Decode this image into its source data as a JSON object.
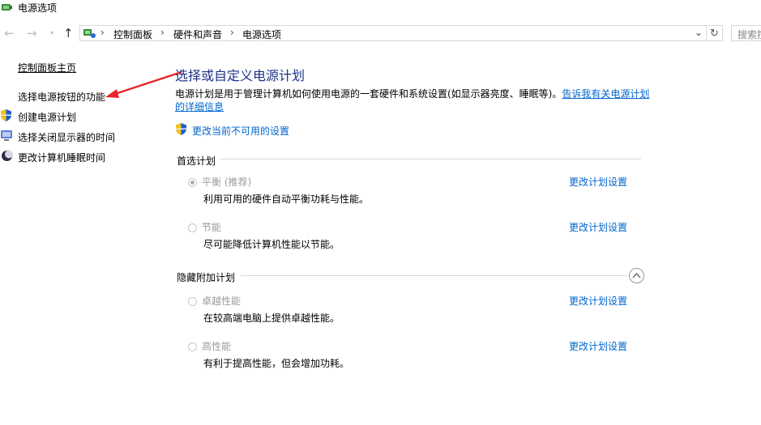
{
  "window": {
    "title": "电源选项",
    "icon": "power-options-icon"
  },
  "nav": {
    "back_icon": "arrow-left-icon",
    "forward_icon": "arrow-right-icon",
    "recent_icon": "chevron-down-icon",
    "up_icon": "arrow-up-icon"
  },
  "address": {
    "breadcrumbs": [
      "控制面板",
      "硬件和声音",
      "电源选项"
    ],
    "separator": "›",
    "dropdown_icon": "chevron-down-icon",
    "refresh_icon": "refresh-icon"
  },
  "search": {
    "placeholder": "搜索控"
  },
  "sidebar": {
    "home": "控制面板主页",
    "items": [
      {
        "label": "选择电源按钮的功能",
        "icon": ""
      },
      {
        "label": "创建电源计划",
        "icon": "shield-icon"
      },
      {
        "label": "选择关闭显示器的时间",
        "icon": "monitor-icon"
      },
      {
        "label": "更改计算机睡眠时间",
        "icon": "moon-icon"
      }
    ]
  },
  "main": {
    "heading": "选择或自定义电源计划",
    "description": "电源计划是用于管理计算机如何使用电源的一套硬件和系统设置(如显示器亮度、睡眠等)。",
    "description_link": "告诉我有关电源计划的详细信息",
    "change_unavailable": "更改当前不可用的设置",
    "preferred_label": "首选计划",
    "hidden_label": "隐藏附加计划",
    "plans": [
      {
        "name": "平衡 (推荐)",
        "desc": "利用可用的硬件自动平衡功耗与性能。",
        "link": "更改计划设置",
        "selected": true
      },
      {
        "name": "节能",
        "desc": "尽可能降低计算机性能以节能。",
        "link": "更改计划设置",
        "selected": false
      }
    ],
    "hidden_plans": [
      {
        "name": "卓越性能",
        "desc": "在较高端电脑上提供卓越性能。",
        "link": "更改计划设置",
        "selected": false
      },
      {
        "name": "高性能",
        "desc": "有利于提高性能，但会增加功耗。",
        "link": "更改计划设置",
        "selected": false
      }
    ]
  },
  "annotation": {
    "color": "#e8262c"
  }
}
